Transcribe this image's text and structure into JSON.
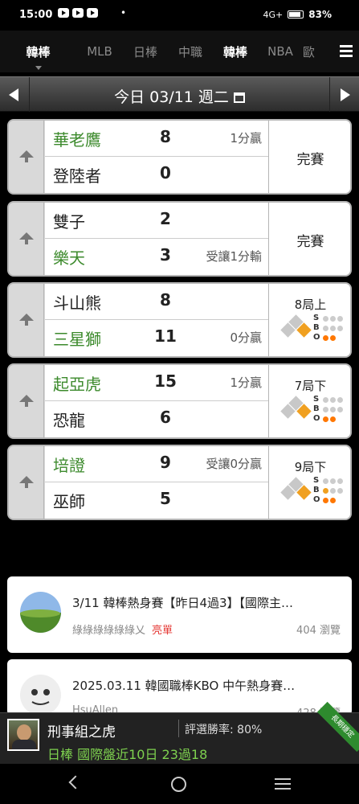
{
  "status_bar": {
    "time": "15:00",
    "dot": "•",
    "network": "4G+",
    "battery": "83%"
  },
  "tabs": [
    {
      "label": "韓棒",
      "active": false
    },
    {
      "label": "MLB",
      "active": false
    },
    {
      "label": "日棒",
      "active": false
    },
    {
      "label": "中職",
      "active": false
    },
    {
      "label": "韓棒",
      "active": true
    },
    {
      "label": "NBA",
      "active": false
    },
    {
      "label": "歐",
      "active": false
    }
  ],
  "date_bar": {
    "date": "今日 03/11 週二"
  },
  "games": [
    {
      "home": "華老鷹",
      "home_score": "8",
      "home_note": "1分贏",
      "home_win": true,
      "away": "登陸者",
      "away_score": "0",
      "away_note": "",
      "away_win": false,
      "status": "完賽",
      "inning": ""
    },
    {
      "home": "雙子",
      "home_score": "2",
      "home_note": "",
      "home_win": false,
      "away": "樂天",
      "away_score": "3",
      "away_note": "受讓1分輸",
      "away_win": true,
      "status": "完賽",
      "inning": ""
    },
    {
      "home": "斗山熊",
      "home_score": "8",
      "home_note": "",
      "home_win": false,
      "away": "三星獅",
      "away_score": "11",
      "away_note": "0分贏",
      "away_win": true,
      "status": "",
      "inning": "8局上",
      "bases": {
        "first": true,
        "second": false,
        "third": false
      },
      "count": {
        "s_label": "S",
        "b_label": "B",
        "o_label": "O",
        "balls": 0,
        "strikes": 0,
        "outs": 2
      }
    },
    {
      "home": "起亞虎",
      "home_score": "15",
      "home_note": "1分贏",
      "home_win": true,
      "away": "恐龍",
      "away_score": "6",
      "away_note": "",
      "away_win": false,
      "status": "",
      "inning": "7局下",
      "bases": {
        "first": true,
        "second": false,
        "third": false
      },
      "count": {
        "s_label": "S",
        "b_label": "B",
        "o_label": "O",
        "balls": 0,
        "strikes": 0,
        "outs": 2
      }
    },
    {
      "home": "培證",
      "home_score": "9",
      "home_note": "受讓0分贏",
      "home_win": true,
      "away": "巫師",
      "away_score": "5",
      "away_note": "",
      "away_win": false,
      "status": "",
      "inning": "9局下",
      "bases": {
        "first": true,
        "second": false,
        "third": false
      },
      "count": {
        "s_label": "S",
        "b_label": "B",
        "o_label": "O",
        "balls": 1,
        "strikes": 0,
        "outs": 2
      }
    }
  ],
  "articles": [
    {
      "title": "3/11 韓棒熱身賽【昨日4過3】【國際主…",
      "author": "綠綠綠綠綠綠乂",
      "highlight": "亮單",
      "views": "404 瀏覽"
    },
    {
      "title": "2025.03.11 韓國職棒KBO 中午熱身賽…",
      "author": "HsuAllen",
      "highlight": "",
      "views": "428 瀏覽"
    }
  ],
  "ad": {
    "name": "刑事組之虎",
    "rate": "評選勝率: 80%",
    "line2": "日棒 國際盤近10日 23過18",
    "ribbon": "長期穩定"
  }
}
